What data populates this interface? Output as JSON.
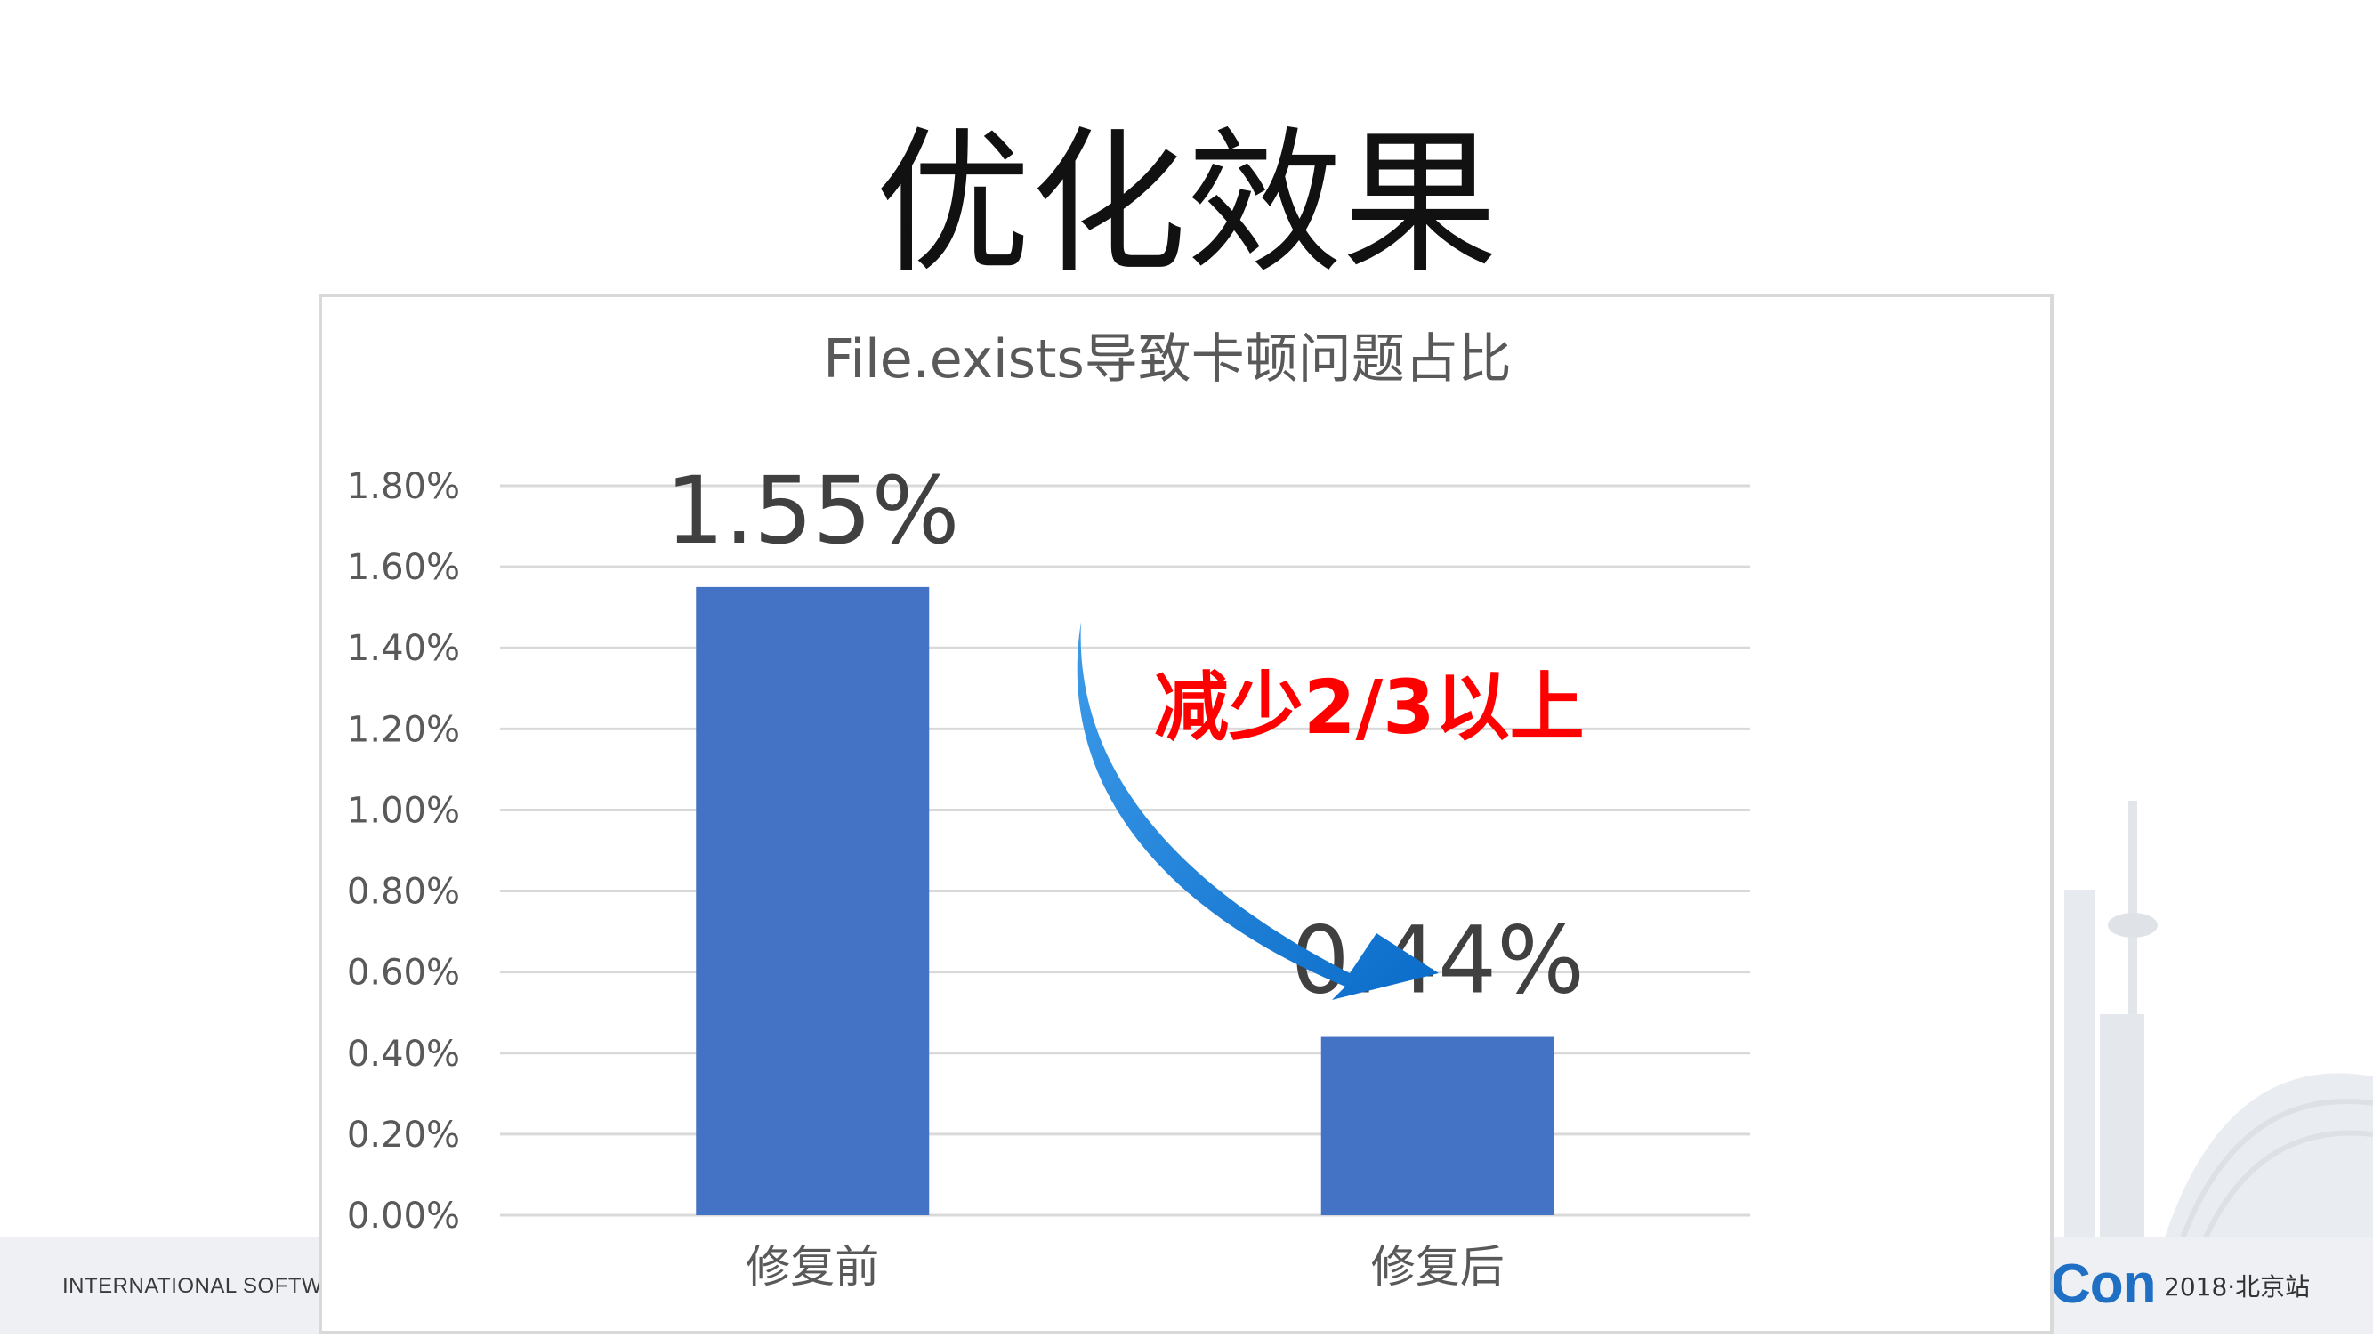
{
  "slide": {
    "title": "优化效果",
    "footer_left": "INTERNATIONAL SOFTWA",
    "footer_logo": "Con",
    "footer_event": "2018·北京站"
  },
  "chart_data": {
    "type": "bar",
    "title": "File.exists导致卡顿问题占比",
    "categories": [
      "修复前",
      "修复后"
    ],
    "values": [
      1.55,
      0.44
    ],
    "value_labels": [
      "1.55%",
      "0.44%"
    ],
    "ylim": [
      0,
      1.8
    ],
    "yticks": [
      "0.00%",
      "0.20%",
      "0.40%",
      "0.60%",
      "0.80%",
      "1.00%",
      "1.20%",
      "1.40%",
      "1.60%",
      "1.80%"
    ],
    "grid": true,
    "legend": "none",
    "annotation": "减少2/3以上",
    "colors": {
      "bar": "#4472c4",
      "grid": "#d9d9d9",
      "annotation_text": "#ff0000",
      "arrow": "#1a7fd4",
      "axis_text": "#595959"
    }
  }
}
